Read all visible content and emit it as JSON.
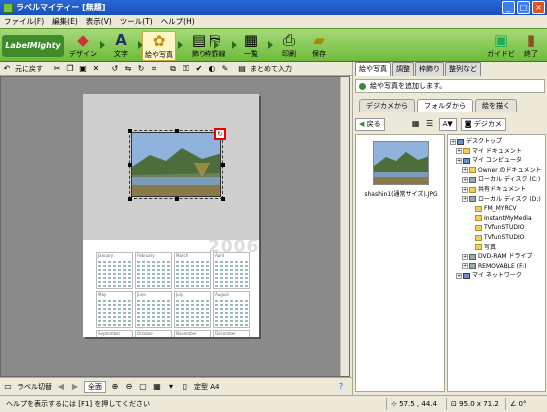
{
  "window": {
    "title": "ラベルマイティー [無題]",
    "controls": [
      "_",
      "□",
      "×"
    ]
  },
  "menu": [
    "ファイル(F)",
    "編集(E)",
    "表示(V)",
    "ツール(T)",
    "ヘルプ(H)"
  ],
  "brand": {
    "logo_text": "LabelMighty"
  },
  "main_toolbar": {
    "design": "デザイン",
    "text": "文字",
    "photo": "絵や写真",
    "decoration": "飾り",
    "frame": "枠罫線",
    "list": "一覧",
    "print": "印刷",
    "save": "保存",
    "guide": "ガイドビュー",
    "exit": "終了"
  },
  "sub_toolbar": {
    "undo_label": "元に戻す",
    "bulk_input_label": "まとめて入力"
  },
  "canvas": {
    "calendar_year": "2006",
    "months": [
      "January",
      "February",
      "March",
      "April",
      "May",
      "June",
      "July",
      "August",
      "September",
      "October",
      "November",
      "December"
    ]
  },
  "bottom_bar": {
    "label_switch": "ラベル切替",
    "fit": "全面",
    "paper_size": "定型 A4"
  },
  "status": {
    "help": "ヘルプを表示するには [F1] を押してください",
    "position": "57.5 , 44.4",
    "size": "95.0 x 71.2",
    "angle": "0°"
  },
  "right_panel": {
    "tabs": [
      "絵や写真",
      "調整",
      "枠飾り",
      "整列など"
    ],
    "description": "絵や写真を追加します。",
    "sub_tabs": [
      "デジカメから",
      "フォルダから",
      "絵を描く"
    ],
    "tools": {
      "back": "戻る",
      "digicam": "デジカメ",
      "sort_label": "A▼"
    },
    "thumbnail_caption": "shashin1(通常サイズ).JPG",
    "tree": [
      {
        "label": "デスクトップ",
        "indent": 0,
        "icon": "desktop"
      },
      {
        "label": "マイ ドキュメント",
        "indent": 1,
        "icon": "folder"
      },
      {
        "label": "マイ コンピュータ",
        "indent": 1,
        "icon": "pc"
      },
      {
        "label": "Owner のドキュメント",
        "indent": 2,
        "icon": "folder"
      },
      {
        "label": "ローカル ディスク (C:)",
        "indent": 2,
        "icon": "drive"
      },
      {
        "label": "共有ドキュメント",
        "indent": 2,
        "icon": "folder"
      },
      {
        "label": "ローカル ディスク (D:)",
        "indent": 2,
        "icon": "drive"
      },
      {
        "label": "FM_MYRCV",
        "indent": 3,
        "icon": "folder"
      },
      {
        "label": "InstantMyMedia",
        "indent": 3,
        "icon": "folder"
      },
      {
        "label": "TVfunSTUDIO",
        "indent": 3,
        "icon": "folder"
      },
      {
        "label": "TVfunSTUDIO",
        "indent": 3,
        "icon": "folder"
      },
      {
        "label": "写真",
        "indent": 3,
        "icon": "folder"
      },
      {
        "label": "DVD-RAM ドライブ",
        "indent": 2,
        "icon": "drive"
      },
      {
        "label": "REMOVABLE (F:)",
        "indent": 2,
        "icon": "drive"
      },
      {
        "label": "マイ ネットワーク",
        "indent": 1,
        "icon": "pc"
      }
    ]
  }
}
